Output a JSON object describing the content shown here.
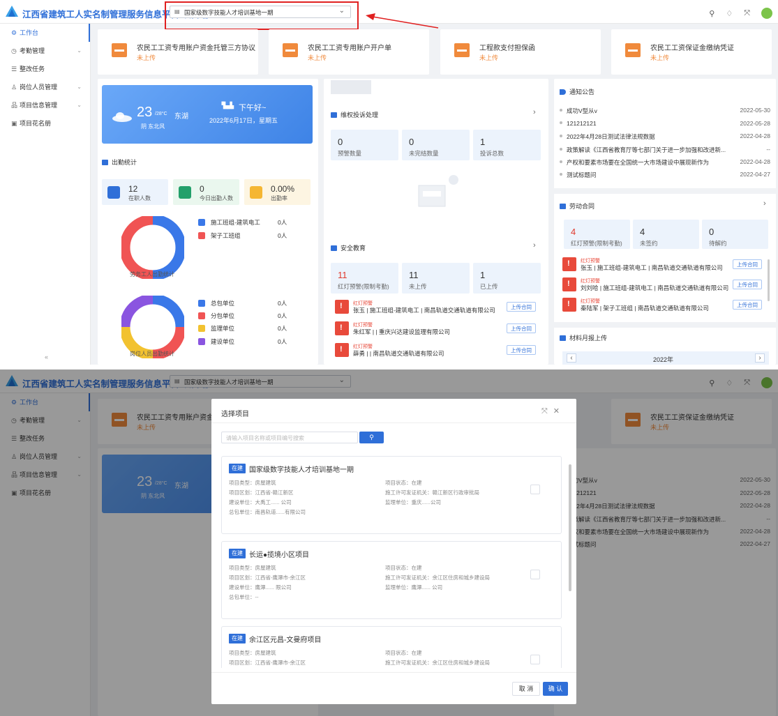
{
  "app": {
    "title": "江西省建筑工人实名制管理服务信息平台-项目端"
  },
  "project_selector": {
    "value": "国家级数字技能人才培训基地一期"
  },
  "sidebar": {
    "items": [
      {
        "label": "工作台",
        "icon": "dashboard-icon"
      },
      {
        "label": "考勤管理",
        "icon": "clock-icon"
      },
      {
        "label": "整改任务",
        "icon": "list-icon"
      },
      {
        "label": "岗位人员管理",
        "icon": "person-icon"
      },
      {
        "label": "项目信息管理",
        "icon": "sitemap-icon"
      },
      {
        "label": "项目花名册",
        "icon": "roster-icon"
      }
    ],
    "collapse": "«"
  },
  "agreements": [
    {
      "title": "农民工工资专用账户资金托管三方协议",
      "status": "未上传"
    },
    {
      "title": "农民工工资专用账户开户单",
      "status": "未上传"
    },
    {
      "title": "工程款支付担保函",
      "status": "未上传"
    },
    {
      "title": "农民工工资保证金缴纳凭证",
      "status": "未上传"
    }
  ],
  "weather": {
    "temp": "23",
    "range": "/28°C",
    "city": "东湖",
    "wind": "阴 东北风",
    "greeting": "下午好~",
    "date": "2022年6月17日，星期五"
  },
  "attendance": {
    "title": "出勤统计",
    "stats": [
      {
        "value": "12",
        "label": "在职人数"
      },
      {
        "value": "0",
        "label": "今日出勤人数"
      },
      {
        "value": "0.00%",
        "label": "出勤率"
      }
    ],
    "chart1_label": "劳务工人出勤统计",
    "chart2_label": "岗位人员出勤统计",
    "legend1": [
      {
        "name": "施工班组-建筑电工",
        "value": "0人",
        "color": "#3a78e8"
      },
      {
        "name": "架子工班组",
        "value": "0人",
        "color": "#f05454"
      }
    ],
    "legend2": [
      {
        "name": "总包单位",
        "value": "0人",
        "color": "#3a78e8"
      },
      {
        "name": "分包单位",
        "value": "0人",
        "color": "#f05454"
      },
      {
        "name": "监理单位",
        "value": "0人",
        "color": "#f2c230"
      },
      {
        "name": "建设单位",
        "value": "0人",
        "color": "#8a55e0"
      }
    ]
  },
  "complaints": {
    "title": "维权投诉处理",
    "stats": [
      {
        "value": "0",
        "label": "预警数量"
      },
      {
        "value": "0",
        "label": "未完结数量"
      },
      {
        "value": "1",
        "label": "投诉总数"
      }
    ]
  },
  "safety": {
    "title": "安全教育",
    "stats": [
      {
        "value": "11",
        "label": "红灯预警(限制考勤)"
      },
      {
        "value": "11",
        "label": "未上传"
      },
      {
        "value": "1",
        "label": "已上传"
      }
    ],
    "warnings": [
      {
        "tag": "红灯预警",
        "text": "张玉 | 施工班组-建筑电工 | 南昌轨道交通轨道有限公司",
        "button": "上传合同"
      },
      {
        "tag": "红灯预警",
        "text": "朱红军 | | 重庆兴达建设监理有限公司",
        "button": "上传合同"
      },
      {
        "tag": "红灯预警",
        "text": "薛勇 | | 南昌轨道交通轨道有限公司",
        "button": "上传合同"
      }
    ]
  },
  "notices": {
    "title": "通知公告",
    "items": [
      {
        "text": "成功V型从v",
        "date": "2022-05-30"
      },
      {
        "text": "121212121",
        "date": "2022-05-28"
      },
      {
        "text": "2022年4月28日测试法律法规数据",
        "date": "2022-04-28"
      },
      {
        "text": "政策解读《江西省教育厅等七部门关于进一步加强和改进新...",
        "date": "--"
      },
      {
        "text": "产权和要素市场要在全国统一大市场建设中展现新作为",
        "date": "2022-04-28"
      },
      {
        "text": "测试标题问",
        "date": "2022-04-27"
      }
    ]
  },
  "labor_contract": {
    "title": "劳动合同",
    "stats": [
      {
        "value": "4",
        "label": "红灯预警(限制考勤)"
      },
      {
        "value": "4",
        "label": "未签约"
      },
      {
        "value": "0",
        "label": "待解约"
      }
    ],
    "warnings": [
      {
        "tag": "红灯预警",
        "text": "张玉 | 施工班组-建筑电工 | 南昌轨道交通轨道有限公司",
        "button": "上传合同"
      },
      {
        "tag": "红灯预警",
        "text": "刘刘哈 | 施工班组-建筑电工 | 南昌轨道交通轨道有限公司",
        "button": "上传合同"
      },
      {
        "tag": "红灯预警",
        "text": "秦陆军 | 架子工班组 | 南昌轨道交通轨道有限公司",
        "button": "上传合同"
      }
    ]
  },
  "materials": {
    "title": "材料月报上传",
    "year": "2022年"
  },
  "modal": {
    "title": "选择项目",
    "search_placeholder": "请输入项目名称或项目编号搜索",
    "cancel": "取 消",
    "confirm": "确 认",
    "projects": [
      {
        "tag": "在建",
        "name": "国家级数字技能人才培训基地一期",
        "fields_left": [
          "项目类型：房屋建筑",
          "项目区划：江西省-赣江新区",
          "建设单位：大禹工...... 公司",
          "总包单位：南昌轨道......有限公司"
        ],
        "fields_right": [
          "项目状态：在建",
          "施工许可发证机关：赣江新区行政审批局",
          "监理单位：重庆......公司"
        ]
      },
      {
        "tag": "在建",
        "name": "长运●揽境小区项目",
        "fields_left": [
          "项目类型：房屋建筑",
          "项目区划：江西省-鹰潭市-余江区",
          "建设单位：鹰潭...... 限公司",
          "总包单位：--"
        ],
        "fields_right": [
          "项目状态：在建",
          "施工许可发证机关：余江区住房和城乡建设局",
          "监理单位：鹰潭...... 公司"
        ]
      },
      {
        "tag": "在建",
        "name": "余江区元昌-文曼府项目",
        "fields_left": [
          "项目类型：房屋建筑",
          "项目区划：江西省-鹰潭市-余江区"
        ],
        "fields_right": [
          "项目状态：在建",
          "施工许可发证机关：余江区住房和城乡建设局"
        ]
      }
    ]
  }
}
